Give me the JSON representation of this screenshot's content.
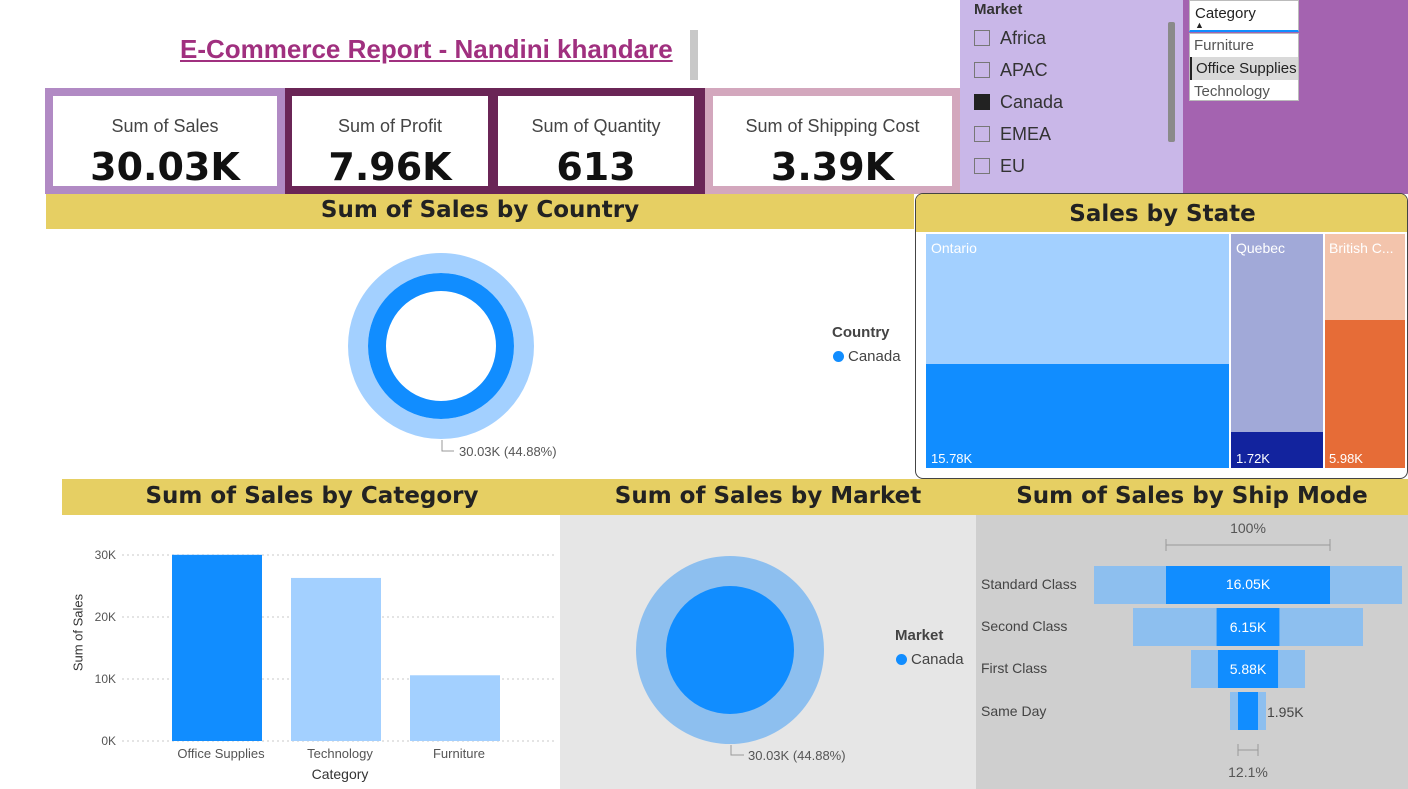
{
  "header": {
    "title": "E-Commerce Report - Nandini khandare"
  },
  "kpis": [
    {
      "label": "Sum of Sales",
      "value": "30.03K"
    },
    {
      "label": "Sum of Profit",
      "value": "7.96K"
    },
    {
      "label": "Sum of Quantity",
      "value": "613"
    },
    {
      "label": "Sum of Shipping Cost",
      "value": "3.39K"
    }
  ],
  "market_slicer": {
    "title": "Market",
    "items": [
      {
        "label": "Africa",
        "checked": false
      },
      {
        "label": "APAC",
        "checked": false
      },
      {
        "label": "Canada",
        "checked": true
      },
      {
        "label": "EMEA",
        "checked": false
      },
      {
        "label": "EU",
        "checked": false
      }
    ]
  },
  "category_slicer": {
    "title": "Category",
    "options": [
      "Furniture",
      "Office Supplies",
      "Technology"
    ],
    "selected": "Office Supplies"
  },
  "country_chart": {
    "title": "Sum of Sales by Country",
    "legend_title": "Country",
    "legend_items": [
      "Canada"
    ],
    "data_label": "30.03K (44.88%)"
  },
  "state_chart": {
    "title": "Sales by State",
    "states": [
      {
        "name": "Ontario",
        "value_label": "15.78K"
      },
      {
        "name": "Quebec",
        "value_label": "1.72K"
      },
      {
        "name": "British C...",
        "value_label": "5.98K"
      }
    ]
  },
  "category_chart": {
    "title": "Sum of Sales by Category",
    "ylabel": "Sum of Sales",
    "xlabel": "Category",
    "yticks": [
      "30K",
      "20K",
      "10K",
      "0K"
    ]
  },
  "market_chart": {
    "title": "Sum of Sales by Market",
    "legend_title": "Market",
    "legend_items": [
      "Canada"
    ],
    "data_label": "30.03K (44.88%)"
  },
  "shipmode_chart": {
    "title": "Sum of Sales by Ship Mode",
    "top_label": "100%",
    "bottom_label": "12.1%",
    "rows": [
      {
        "mode": "Standard Class",
        "value_label": "16.05K"
      },
      {
        "mode": "Second Class",
        "value_label": "6.15K"
      },
      {
        "mode": "First Class",
        "value_label": "5.88K"
      },
      {
        "mode": "Same Day",
        "value_label": "1.95K"
      }
    ]
  },
  "chart_data": [
    {
      "type": "bar",
      "title": "Sum of Sales by Category",
      "xlabel": "Category",
      "ylabel": "Sum of Sales",
      "categories": [
        "Office Supplies",
        "Technology",
        "Furniture"
      ],
      "values": [
        30030,
        26300,
        10600
      ],
      "ylim": [
        0,
        30000
      ],
      "highlighted": "Office Supplies",
      "colors": {
        "highlighted": "#118dff",
        "others": "#a3d0ff"
      }
    },
    {
      "type": "pie",
      "title": "Sum of Sales by Country",
      "categories": [
        "Canada"
      ],
      "values": [
        30030
      ],
      "highlighted_share_pct": 44.88
    },
    {
      "type": "pie",
      "title": "Sum of Sales by Market",
      "categories": [
        "Canada"
      ],
      "values": [
        30030
      ],
      "highlighted_share_pct": 44.88
    },
    {
      "type": "treemap",
      "title": "Sales by State",
      "categories": [
        "Ontario",
        "Quebec",
        "British C..."
      ],
      "values": [
        15780,
        1720,
        5980
      ]
    },
    {
      "type": "funnel",
      "title": "Sum of Sales by Ship Mode",
      "categories": [
        "Standard Class",
        "Second Class",
        "First Class",
        "Same Day"
      ],
      "values": [
        16050,
        6150,
        5880,
        1950
      ]
    }
  ],
  "colors": {
    "accent": "#118dff",
    "light_accent": "#a3d0ff",
    "header_band": "#e6cf63",
    "title_color": "#a0307f",
    "slicer_bg": "#c9b7e8",
    "category_panel_bg": "#a463b0",
    "quebec": "#a1a9d8",
    "quebec_dark": "#12239e",
    "bc_light": "#f3c4ac",
    "bc_dark": "#e66c37"
  }
}
